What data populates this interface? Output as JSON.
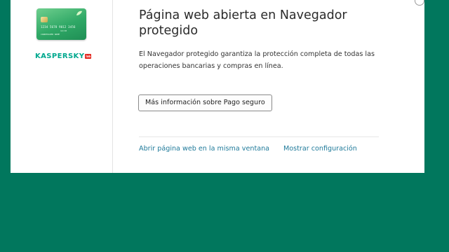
{
  "card": {
    "number": "1234 5678 9012 3456",
    "expiry": "12/18",
    "holder": "CARDHOLDER NAME"
  },
  "brand": {
    "name": "KASPERSKY",
    "lab": "lab",
    "color": "#00a88e"
  },
  "dialog": {
    "title": "Página web abierta en Navegador protegido",
    "description": "El Navegador protegido garantiza la protección completa de todas las operaciones bancarias y compras en línea.",
    "info_button_label": "Más información sobre Pago seguro",
    "open_same_window_link": "Abrir página web en la misma ventana",
    "show_settings_link": "Mostrar configuración"
  },
  "colors": {
    "background": "#01775d",
    "link": "#1f7a9a",
    "card_green": "#2fa866"
  }
}
